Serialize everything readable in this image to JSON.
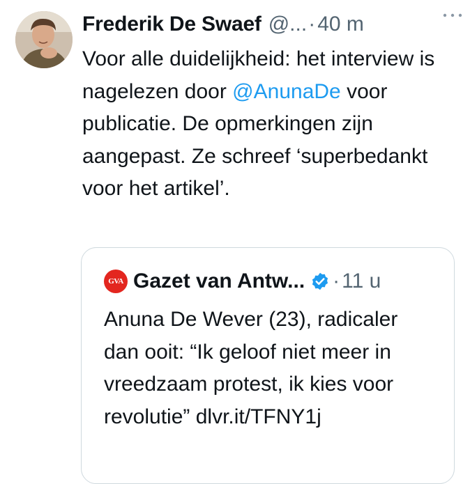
{
  "tweet": {
    "author_name": "Frederik De Swaef",
    "handle": "@...",
    "separator": "·",
    "time": "40 m",
    "text_before_mention": "Voor alle duidelijkheid: het interview is nagelezen door ",
    "mention": "@AnunaDe",
    "text_after_mention": " voor publicatie. De opmerkingen zijn aangepast. Ze schreef ‘superbedankt voor het artikel’."
  },
  "quoted_tweet": {
    "logo_text": "GVA",
    "author_name": "Gazet van Antw...",
    "separator": "·",
    "time": "11 u",
    "text": "Anuna De Wever (23), radicaler dan ooit: “Ik geloof niet meer in vreedzaam protest, ik kies voor revolutie” dlvr.it/TFNY1j"
  },
  "colors": {
    "link": "#1d9bf0",
    "secondary_text": "#536471",
    "verified_badge": "#1d9bf0",
    "brand_red": "#e3261f",
    "border": "#cfd9de"
  },
  "icons": {
    "more": "more-horizontal-icon",
    "verified": "verified-badge-icon"
  }
}
